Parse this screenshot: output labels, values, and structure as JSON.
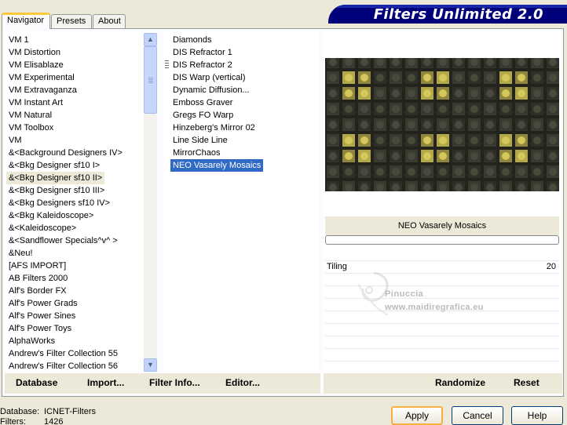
{
  "tabs": [
    "Navigator",
    "Presets",
    "About"
  ],
  "banner": {
    "title": "Filters Unlimited 2.0"
  },
  "categories": [
    "VM 1",
    "VM Distortion",
    "VM Elisablaze",
    "VM Experimental",
    "VM Extravaganza",
    "VM Instant Art",
    "VM Natural",
    "VM Toolbox",
    "VM",
    "&<Background Designers IV>",
    "&<Bkg Designer sf10 I>",
    "&<Bkg Designer sf10 II>",
    "&<Bkg Designer sf10 III>",
    "&<Bkg Designers sf10 IV>",
    "&<Bkg Kaleidoscope>",
    "&<Kaleidoscope>",
    "&<Sandflower Specials^v^ >",
    "&Neu!",
    "[AFS IMPORT]",
    "AB Filters 2000",
    "Alf's Border FX",
    "Alf's Power Grads",
    "Alf's Power Sines",
    "Alf's Power Toys",
    "AlphaWorks",
    "Andrew's Filter Collection 55",
    "Andrew's Filter Collection 56"
  ],
  "selected_category_index": 11,
  "filters": [
    "Diamonds",
    "DIS Refractor 1",
    "DIS Refractor 2",
    "DIS Warp (vertical)",
    "Dynamic Diffusion...",
    "Emboss Graver",
    "Gregs FO Warp",
    "Hinzeberg's Mirror 02",
    "Line Side Line",
    "MirrorChaos",
    "NEO Vasarely Mosaics"
  ],
  "selected_filter_index": 10,
  "preview": {
    "filter_name": "NEO Vasarely Mosaics"
  },
  "params": [
    {
      "label": "Tiling",
      "value": "20"
    }
  ],
  "watermark": {
    "line1": "Pinuccia",
    "line2": "www.maidiregrafica.eu"
  },
  "left_links": [
    "Database",
    "Import...",
    "Filter Info...",
    "Editor..."
  ],
  "right_links": [
    "Randomize",
    "Reset"
  ],
  "status": {
    "database_label": "Database:",
    "database_value": "ICNET-Filters",
    "filters_label": "Filters:",
    "filters_value": "1426"
  },
  "buttons": {
    "apply": "Apply",
    "cancel": "Cancel",
    "help": "Help"
  },
  "colors": {
    "banner": "#00007b",
    "selection": "#316ac5",
    "active_tab_accent": "#ffc83c"
  }
}
